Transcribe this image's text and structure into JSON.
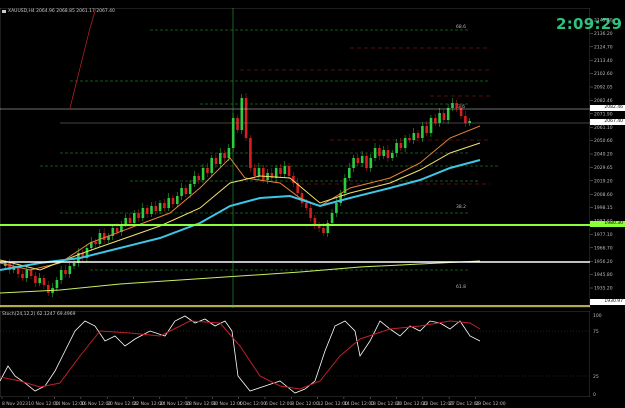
{
  "symbol": "XAUUSD,H4  2064.96 2068.85 2061.17 2067.40",
  "oscillator_label": "Stoch(24,12,2) 62.1247 69.4969",
  "countdown": "2:09:29",
  "colors": {
    "background": "#000000",
    "bull": "#2ecc40",
    "bear": "#d62020",
    "ema_fast": "#e8823a",
    "ema_mid": "#f2e26b",
    "ema_slow": "#3fc6e6",
    "ema_long": "#c8f060",
    "support": "#8cff3a",
    "resistance": "#ffffff",
    "stoch_main": "#ffffff",
    "stoch_signal": "#c0202a"
  },
  "price_axis": [
    "2145.70",
    "2136.20",
    "2124.70",
    "2113.40",
    "2102.60",
    "2092.05",
    "2082.46",
    "2071.90",
    "2061.10",
    "2050.60",
    "2040.20",
    "2029.65",
    "2019.20",
    "2008.60",
    "1998.15",
    "1987.60",
    "1977.10",
    "1966.70",
    "1956.20",
    "1945.80",
    "1935.20",
    "1924.80"
  ],
  "price_labels": {
    "current": "2067.40",
    "resist": "2082.46",
    "support": "1980.30",
    "low": "1930.97"
  },
  "level_tags": [
    "68.6",
    "23.6",
    "38.2",
    "61.8"
  ],
  "stoch_axis": [
    "100",
    "75",
    "25",
    "0"
  ],
  "time_axis": [
    "8 Nov 2023",
    "10 Nov 12:00",
    "14 Nov 12:00",
    "16 Nov 12:00",
    "20 Nov 12:00",
    "22 Nov 12:00",
    "24 Nov 12:00",
    "28 Nov 12:00",
    "30 Nov 12:00",
    "4 Dec 12:00",
    "6 Dec 12:00",
    "8 Dec 12:00",
    "12 Dec 12:00",
    "14 Dec 12:00",
    "18 Dec 12:00",
    "20 Dec 12:00",
    "22 Dec 12:00",
    "27 Dec 12:00",
    "29 Dec 12:00"
  ]
}
